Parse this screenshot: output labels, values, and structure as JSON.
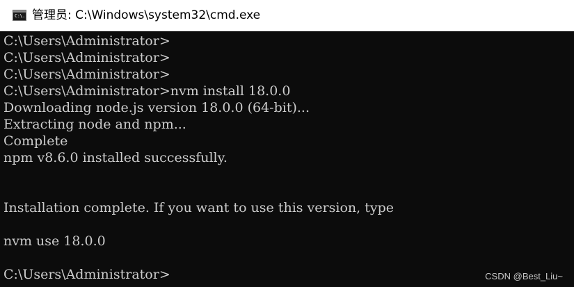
{
  "window": {
    "title": "管理员: C:\\Windows\\system32\\cmd.exe",
    "icon": "cmd-console-icon",
    "icon_text": "C:\\."
  },
  "console": {
    "lines": [
      "C:\\Users\\Administrator>",
      "C:\\Users\\Administrator>",
      "C:\\Users\\Administrator>",
      "C:\\Users\\Administrator>nvm install 18.0.0",
      "Downloading node.js version 18.0.0 (64-bit)...",
      "Extracting node and npm...",
      "Complete",
      "npm v8.6.0 installed successfully.",
      "",
      "",
      "Installation complete. If you want to use this version, type",
      "",
      "nvm use 18.0.0",
      "",
      "C:\\Users\\Administrator>"
    ]
  },
  "watermark": "CSDN @Best_Liu~",
  "colors": {
    "console_background": "#0c0c0c",
    "console_text": "#cccccc",
    "titlebar_background": "#ffffff"
  }
}
